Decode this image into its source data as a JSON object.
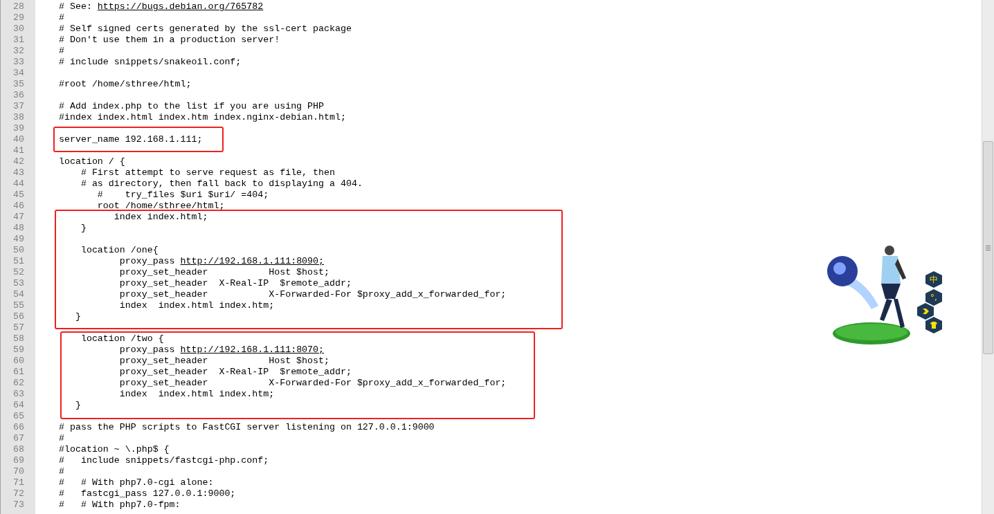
{
  "blocks": [
    {
      "framed": false,
      "lines": [
        {
          "n": "28",
          "text": "# See: ",
          "link": "https://bugs.debian.org/765782"
        },
        {
          "n": "29",
          "text": "#"
        },
        {
          "n": "30",
          "text": "# Self signed certs generated by the ssl-cert package"
        },
        {
          "n": "31",
          "text": "# Don't use them in a production server!"
        },
        {
          "n": "32",
          "text": "#"
        },
        {
          "n": "33",
          "text": "# include snippets/snakeoil.conf;"
        },
        {
          "n": "34"
        },
        {
          "n": "35",
          "text": "#root /home/sthree/html;"
        },
        {
          "n": "36"
        },
        {
          "n": "37",
          "text": "# Add index.php to the list if you are using PHP"
        },
        {
          "n": "38",
          "text": "#index index.html index.htm index.nginx-debian.html;"
        }
      ]
    },
    {
      "framed": true,
      "lines": [
        {
          "n": "39"
        },
        {
          "n": "40",
          "text": "server_name 192.168.1.111;"
        },
        {
          "n": "41"
        }
      ]
    },
    {
      "framed": false,
      "lines": [
        {
          "n": "42",
          "text": "location / {"
        },
        {
          "n": "43",
          "text": "    # First attempt to serve request as file, then"
        },
        {
          "n": "44",
          "text": "    # as directory, then fall back to displaying a 404."
        },
        {
          "n": "45",
          "text": "       #    try_files $uri $uri/ =404;"
        },
        {
          "n": "46",
          "text": "       root /home/sthree/html;"
        }
      ]
    },
    {
      "framed": true,
      "lines": [
        {
          "n": "47",
          "text": "          index index.html;"
        },
        {
          "n": "48",
          "text": "    }"
        },
        {
          "n": "49"
        },
        {
          "n": "50",
          "text": "    location /one{"
        },
        {
          "n": "51",
          "text": "           proxy_pass ",
          "link": "http://192.168.1.111:8090;"
        },
        {
          "n": "52",
          "text": "           proxy_set_header           Host $host;"
        },
        {
          "n": "53",
          "text": "           proxy_set_header  X-Real-IP  $remote_addr;"
        },
        {
          "n": "54",
          "text": "           proxy_set_header           X-Forwarded-For $proxy_add_x_forwarded_for;"
        },
        {
          "n": "55",
          "text": "           index  index.html index.htm;"
        },
        {
          "n": "56",
          "text": "   }"
        },
        {
          "n": "57"
        }
      ]
    },
    {
      "framed": true,
      "lines": [
        {
          "n": "58",
          "text": "    location /two {"
        },
        {
          "n": "59",
          "text": "           proxy_pass ",
          "link": "http://192.168.1.111:8070;"
        },
        {
          "n": "60",
          "text": "           proxy_set_header           Host $host;"
        },
        {
          "n": "61",
          "text": "           proxy_set_header  X-Real-IP  $remote_addr;"
        },
        {
          "n": "62",
          "text": "           proxy_set_header           X-Forwarded-For $proxy_add_x_forwarded_for;"
        },
        {
          "n": "63",
          "text": "           index  index.html index.htm;"
        },
        {
          "n": "64",
          "text": "   }"
        },
        {
          "n": "65"
        }
      ]
    },
    {
      "framed": false,
      "lines": [
        {
          "n": "66",
          "text": "# pass the PHP scripts to FastCGI server listening on 127.0.0.1:9000"
        },
        {
          "n": "67",
          "text": "#"
        },
        {
          "n": "68",
          "text": "#location ~ \\.php$ {"
        },
        {
          "n": "69",
          "text": "#   include snippets/fastcgi-php.conf;"
        },
        {
          "n": "70",
          "text": "#"
        },
        {
          "n": "71",
          "text": "#   # With php7.0-cgi alone:"
        },
        {
          "n": "72",
          "text": "#   fastcgi_pass 127.0.0.1:9000;"
        },
        {
          "n": "73",
          "text": "#   # With php7.0-fpm:"
        }
      ]
    }
  ],
  "ime_toolbar": [
    {
      "kind": "text",
      "label": "中"
    },
    {
      "kind": "text",
      "label": "°,"
    },
    {
      "kind": "arrow"
    },
    {
      "kind": "shirt"
    }
  ]
}
